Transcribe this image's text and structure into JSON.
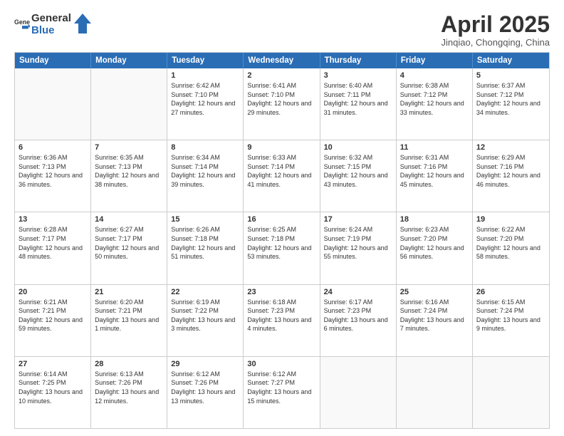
{
  "header": {
    "logo_general": "General",
    "logo_blue": "Blue",
    "month_title": "April 2025",
    "location": "Jinqiao, Chongqing, China"
  },
  "weekdays": [
    "Sunday",
    "Monday",
    "Tuesday",
    "Wednesday",
    "Thursday",
    "Friday",
    "Saturday"
  ],
  "rows": [
    [
      {
        "day": "",
        "text": ""
      },
      {
        "day": "",
        "text": ""
      },
      {
        "day": "1",
        "text": "Sunrise: 6:42 AM\nSunset: 7:10 PM\nDaylight: 12 hours and 27 minutes."
      },
      {
        "day": "2",
        "text": "Sunrise: 6:41 AM\nSunset: 7:10 PM\nDaylight: 12 hours and 29 minutes."
      },
      {
        "day": "3",
        "text": "Sunrise: 6:40 AM\nSunset: 7:11 PM\nDaylight: 12 hours and 31 minutes."
      },
      {
        "day": "4",
        "text": "Sunrise: 6:38 AM\nSunset: 7:12 PM\nDaylight: 12 hours and 33 minutes."
      },
      {
        "day": "5",
        "text": "Sunrise: 6:37 AM\nSunset: 7:12 PM\nDaylight: 12 hours and 34 minutes."
      }
    ],
    [
      {
        "day": "6",
        "text": "Sunrise: 6:36 AM\nSunset: 7:13 PM\nDaylight: 12 hours and 36 minutes."
      },
      {
        "day": "7",
        "text": "Sunrise: 6:35 AM\nSunset: 7:13 PM\nDaylight: 12 hours and 38 minutes."
      },
      {
        "day": "8",
        "text": "Sunrise: 6:34 AM\nSunset: 7:14 PM\nDaylight: 12 hours and 39 minutes."
      },
      {
        "day": "9",
        "text": "Sunrise: 6:33 AM\nSunset: 7:14 PM\nDaylight: 12 hours and 41 minutes."
      },
      {
        "day": "10",
        "text": "Sunrise: 6:32 AM\nSunset: 7:15 PM\nDaylight: 12 hours and 43 minutes."
      },
      {
        "day": "11",
        "text": "Sunrise: 6:31 AM\nSunset: 7:16 PM\nDaylight: 12 hours and 45 minutes."
      },
      {
        "day": "12",
        "text": "Sunrise: 6:29 AM\nSunset: 7:16 PM\nDaylight: 12 hours and 46 minutes."
      }
    ],
    [
      {
        "day": "13",
        "text": "Sunrise: 6:28 AM\nSunset: 7:17 PM\nDaylight: 12 hours and 48 minutes."
      },
      {
        "day": "14",
        "text": "Sunrise: 6:27 AM\nSunset: 7:17 PM\nDaylight: 12 hours and 50 minutes."
      },
      {
        "day": "15",
        "text": "Sunrise: 6:26 AM\nSunset: 7:18 PM\nDaylight: 12 hours and 51 minutes."
      },
      {
        "day": "16",
        "text": "Sunrise: 6:25 AM\nSunset: 7:18 PM\nDaylight: 12 hours and 53 minutes."
      },
      {
        "day": "17",
        "text": "Sunrise: 6:24 AM\nSunset: 7:19 PM\nDaylight: 12 hours and 55 minutes."
      },
      {
        "day": "18",
        "text": "Sunrise: 6:23 AM\nSunset: 7:20 PM\nDaylight: 12 hours and 56 minutes."
      },
      {
        "day": "19",
        "text": "Sunrise: 6:22 AM\nSunset: 7:20 PM\nDaylight: 12 hours and 58 minutes."
      }
    ],
    [
      {
        "day": "20",
        "text": "Sunrise: 6:21 AM\nSunset: 7:21 PM\nDaylight: 12 hours and 59 minutes."
      },
      {
        "day": "21",
        "text": "Sunrise: 6:20 AM\nSunset: 7:21 PM\nDaylight: 13 hours and 1 minute."
      },
      {
        "day": "22",
        "text": "Sunrise: 6:19 AM\nSunset: 7:22 PM\nDaylight: 13 hours and 3 minutes."
      },
      {
        "day": "23",
        "text": "Sunrise: 6:18 AM\nSunset: 7:23 PM\nDaylight: 13 hours and 4 minutes."
      },
      {
        "day": "24",
        "text": "Sunrise: 6:17 AM\nSunset: 7:23 PM\nDaylight: 13 hours and 6 minutes."
      },
      {
        "day": "25",
        "text": "Sunrise: 6:16 AM\nSunset: 7:24 PM\nDaylight: 13 hours and 7 minutes."
      },
      {
        "day": "26",
        "text": "Sunrise: 6:15 AM\nSunset: 7:24 PM\nDaylight: 13 hours and 9 minutes."
      }
    ],
    [
      {
        "day": "27",
        "text": "Sunrise: 6:14 AM\nSunset: 7:25 PM\nDaylight: 13 hours and 10 minutes."
      },
      {
        "day": "28",
        "text": "Sunrise: 6:13 AM\nSunset: 7:26 PM\nDaylight: 13 hours and 12 minutes."
      },
      {
        "day": "29",
        "text": "Sunrise: 6:12 AM\nSunset: 7:26 PM\nDaylight: 13 hours and 13 minutes."
      },
      {
        "day": "30",
        "text": "Sunrise: 6:12 AM\nSunset: 7:27 PM\nDaylight: 13 hours and 15 minutes."
      },
      {
        "day": "",
        "text": ""
      },
      {
        "day": "",
        "text": ""
      },
      {
        "day": "",
        "text": ""
      }
    ]
  ]
}
